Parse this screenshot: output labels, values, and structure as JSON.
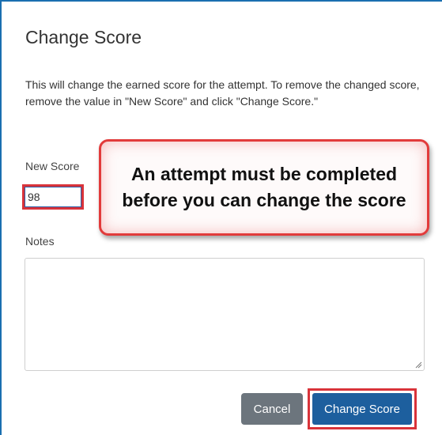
{
  "dialog": {
    "title": "Change Score",
    "description": "This will change the earned score for the attempt. To remove the changed score, remove the value in \"New Score\" and click \"Change Score.\"",
    "new_score_label": "New Score",
    "new_score_value": "98",
    "notes_label": "Notes",
    "notes_value": "",
    "cancel_label": "Cancel",
    "change_score_label": "Change Score"
  },
  "callout": {
    "text": "An attempt must be completed before you can change the score"
  },
  "colors": {
    "frame": "#1a6fb0",
    "highlight": "#d9333a",
    "primary_button": "#1d5f9e",
    "secondary_button": "#6c757d"
  },
  "icons": {
    "textarea_resize": "resize-handle-icon"
  }
}
